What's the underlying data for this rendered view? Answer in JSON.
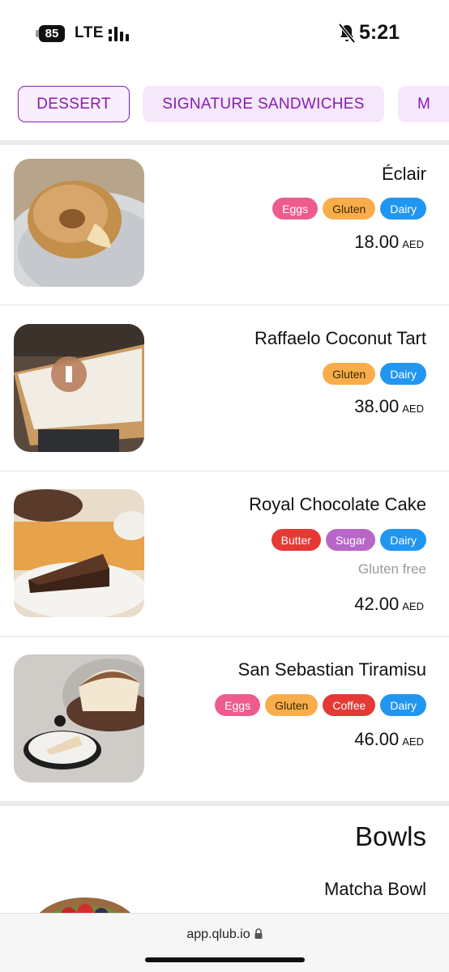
{
  "status_bar": {
    "battery": "85",
    "network": "LTE",
    "time": "5:21",
    "icons": [
      "battery-icon",
      "signal-icon",
      "bell-off-icon"
    ]
  },
  "tabs": [
    {
      "label": "DESSERT",
      "active": true
    },
    {
      "label": "SIGNATURE SANDWICHES",
      "active": false
    },
    {
      "label": "M",
      "active": false
    }
  ],
  "items": [
    {
      "name": "Éclair",
      "tags": [
        "Eggs",
        "Gluten",
        "Dairy"
      ],
      "note": "",
      "price": "18.00",
      "currency": "AED"
    },
    {
      "name": "Raffaelo Coconut Tart",
      "tags": [
        "Gluten",
        "Dairy"
      ],
      "note": "",
      "price": "38.00",
      "currency": "AED"
    },
    {
      "name": "Royal Chocolate Cake",
      "tags": [
        "Butter",
        "Sugar",
        "Dairy"
      ],
      "note": "Gluten free",
      "price": "42.00",
      "currency": "AED"
    },
    {
      "name": "San Sebastian Tiramisu",
      "tags": [
        "Eggs",
        "Gluten",
        "Coffee",
        "Dairy"
      ],
      "note": "",
      "price": "46.00",
      "currency": "AED"
    }
  ],
  "section": {
    "title": "Bowls",
    "first_item": "Matcha Bowl"
  },
  "browser": {
    "url": "app.qlub.io"
  },
  "colors": {
    "accent": "#8a1ab5",
    "tab_background": "#f4e8fa",
    "eggs": "#ee5c8c",
    "gluten": "#f9ad4a",
    "dairy": "#2196f0",
    "butter": "#e53935",
    "sugar": "#b867c9",
    "coffee": "#e53935"
  }
}
